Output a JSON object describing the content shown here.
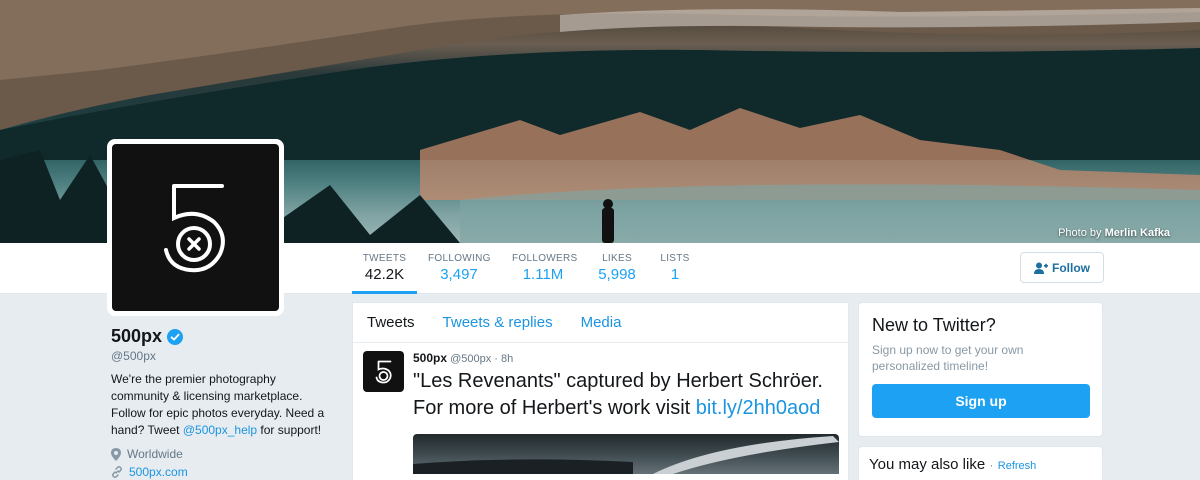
{
  "banner": {
    "credit_prefix": "Photo by",
    "credit_author": "Merlin Kafka"
  },
  "nav": {
    "stats": [
      {
        "label": "TWEETS",
        "value": "42.2K"
      },
      {
        "label": "FOLLOWING",
        "value": "3,497"
      },
      {
        "label": "FOLLOWERS",
        "value": "1.11M"
      },
      {
        "label": "LIKES",
        "value": "5,998"
      },
      {
        "label": "LISTS",
        "value": "1"
      }
    ],
    "follow_label": "Follow"
  },
  "profile": {
    "name": "500px",
    "handle": "@500px",
    "bio_text": "We're the premier photography community & licensing marketplace. Follow for epic photos everyday. Need a hand? Tweet ",
    "bio_link": "@500px_help",
    "bio_suffix": " for support!",
    "location": "Worldwide",
    "website": "500px.com"
  },
  "timeline": {
    "tabs": [
      "Tweets",
      "Tweets & replies",
      "Media"
    ],
    "tweet": {
      "author": "500px",
      "handle": "@500px",
      "time": "8h",
      "text": "\"Les Revenants\" captured by Herbert Schröer. For more of Herbert's work visit",
      "link": "bit.ly/2hh0aod"
    }
  },
  "sidebar": {
    "new_title": "New to Twitter?",
    "new_text": "Sign up now to get your own personalized timeline!",
    "signup_label": "Sign up",
    "may_like_title": "You may also like",
    "refresh_label": "Refresh"
  },
  "colors": {
    "accent": "#1da1f2",
    "link": "#1b95e0",
    "background": "#e6ecf0"
  },
  "icons": [
    "verified-icon",
    "location-pin-icon",
    "link-icon",
    "follow-person-icon",
    "500px-logo-icon"
  ]
}
